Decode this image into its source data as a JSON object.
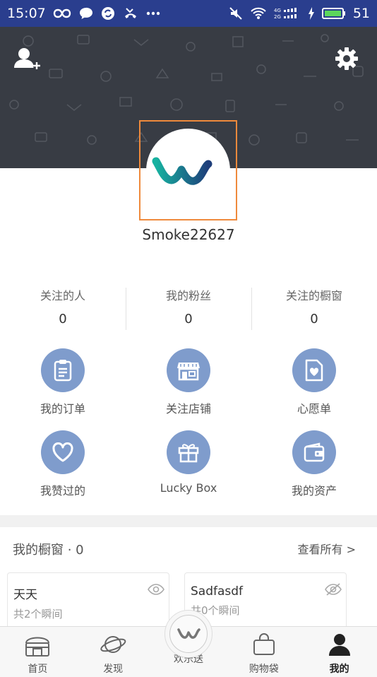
{
  "status_bar": {
    "time": "15:07",
    "battery": "51",
    "background": "#2a3e8e"
  },
  "header": {
    "background": "#383c44",
    "add_friend_icon": "add-person-icon",
    "settings_icon": "gear-icon"
  },
  "profile": {
    "username": "Smoke22627",
    "avatar_colors": [
      "#17b2a0",
      "#1e3e7a"
    ],
    "highlight_color": "#ef8a3c"
  },
  "stats": [
    {
      "label": "关注的人",
      "value": "0"
    },
    {
      "label": "我的粉丝",
      "value": "0"
    },
    {
      "label": "关注的橱窗",
      "value": "0"
    }
  ],
  "menu": [
    {
      "label": "我的订单",
      "icon": "clipboard-icon"
    },
    {
      "label": "关注店铺",
      "icon": "store-icon"
    },
    {
      "label": "心愿单",
      "icon": "heart-document-icon"
    },
    {
      "label": "我赞过的",
      "icon": "heart-icon"
    },
    {
      "label": "Lucky Box",
      "icon": "gift-icon"
    },
    {
      "label": "我的资产",
      "icon": "wallet-icon"
    }
  ],
  "menu_icon_color": "#7f9ccc",
  "showcase": {
    "title": "我的橱窗",
    "count": "· 0",
    "view_all": "查看所有 >",
    "cards": [
      {
        "title": "天天",
        "subtitle": "共2个瞬间",
        "icon": "eye-icon"
      },
      {
        "title": "Sadfasdf",
        "subtitle": "共0个瞬间",
        "icon": "eye-off-icon"
      }
    ]
  },
  "bottom_nav": [
    {
      "label": "首页",
      "icon": "home-icon"
    },
    {
      "label": "发现",
      "icon": "planet-icon"
    },
    {
      "label": "欢乐送",
      "icon": "logo-w-icon"
    },
    {
      "label": "购物袋",
      "icon": "shopping-bag-icon"
    },
    {
      "label": "我的",
      "icon": "person-icon",
      "active": true
    }
  ]
}
